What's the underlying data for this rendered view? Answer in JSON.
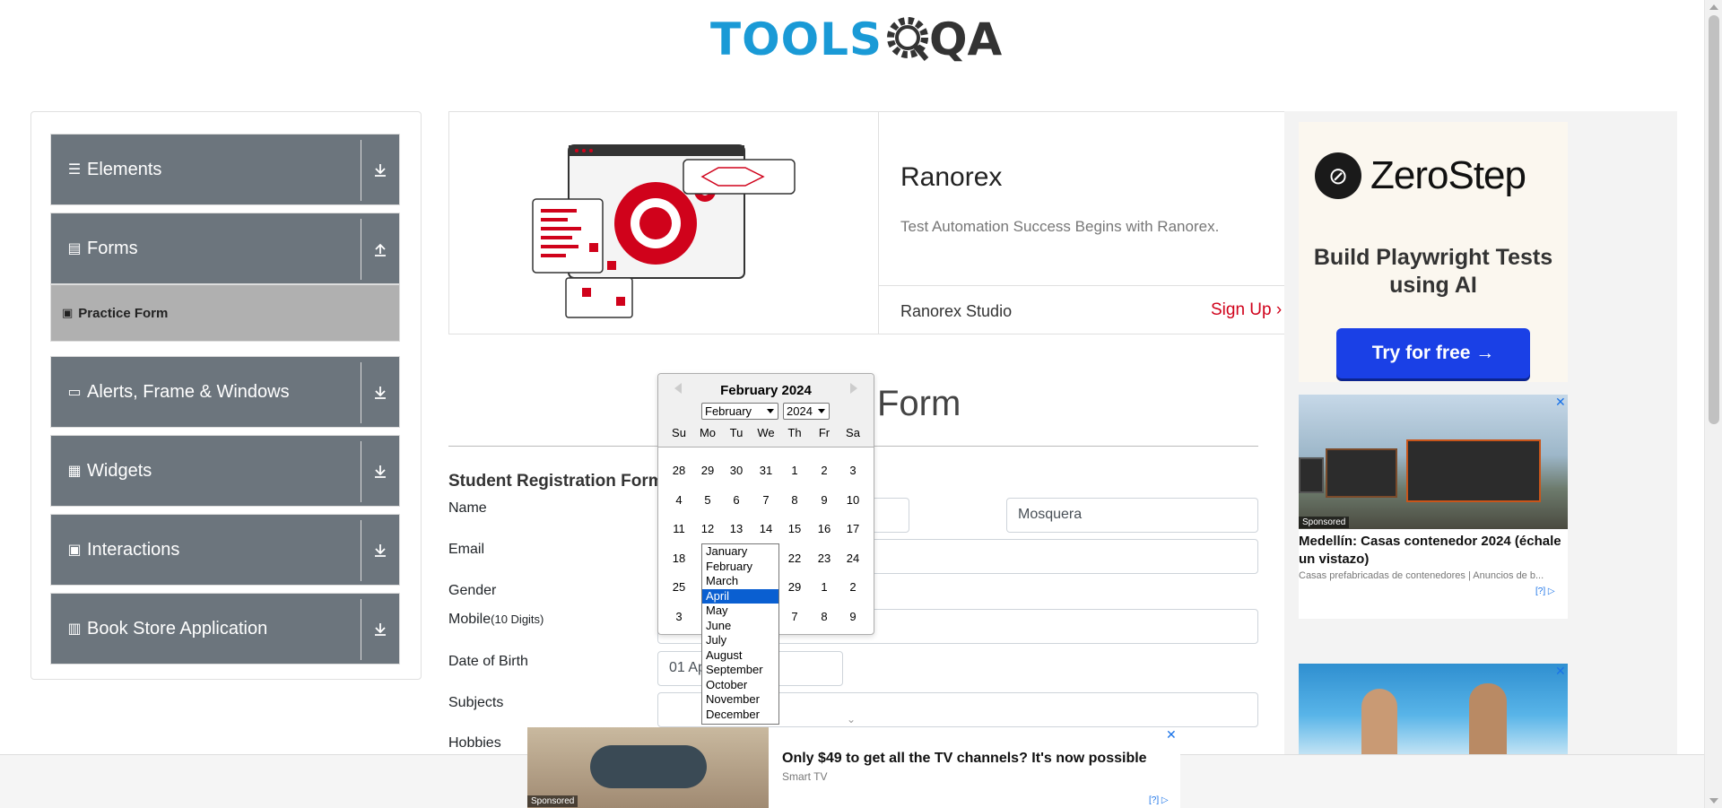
{
  "header": {
    "logo_tools": "TOOLS",
    "logo_qa": "QA"
  },
  "sidebar": {
    "groups": [
      {
        "label": "Elements",
        "icon": "hamburger-icon",
        "arrow": "download-icon"
      },
      {
        "label": "Forms",
        "icon": "document-icon",
        "arrow": "upload-icon"
      },
      {
        "label": "Alerts, Frame & Windows",
        "icon": "window-icon",
        "arrow": "download-icon"
      },
      {
        "label": "Widgets",
        "icon": "grid-icon",
        "arrow": "download-icon"
      },
      {
        "label": "Interactions",
        "icon": "interaction-icon",
        "arrow": "download-icon"
      },
      {
        "label": "Book Store Application",
        "icon": "books-icon",
        "arrow": "download-icon"
      }
    ],
    "active_item": "Practice Form"
  },
  "banner": {
    "title": "Ranorex",
    "subtitle": "Test Automation Success Begins with Ranorex.",
    "product": "Ranorex Studio",
    "cta": "Sign Up"
  },
  "form": {
    "page_title": "Form",
    "heading": "Student Registration Form",
    "labels": {
      "name": "Name",
      "email": "Email",
      "gender": "Gender",
      "mobile": "Mobile",
      "mobile_hint": "(10 Digits)",
      "dob": "Date of Birth",
      "subjects": "Subjects",
      "hobbies": "Hobbies"
    },
    "last_name_value": "Mosquera",
    "dob_value": "01 Ap"
  },
  "datepicker": {
    "header": "February 2024",
    "month_select": "February",
    "year_select": "2024",
    "weekdays": [
      "Su",
      "Mo",
      "Tu",
      "We",
      "Th",
      "Fr",
      "Sa"
    ],
    "weeks": [
      [
        "28",
        "29",
        "30",
        "31",
        "1",
        "2",
        "3"
      ],
      [
        "4",
        "5",
        "6",
        "7",
        "8",
        "9",
        "10"
      ],
      [
        "11",
        "12",
        "13",
        "14",
        "15",
        "16",
        "17"
      ],
      [
        "18",
        "",
        "",
        "",
        "22",
        "23",
        "24"
      ],
      [
        "25",
        "",
        "",
        "",
        "29",
        "1",
        "2"
      ],
      [
        "3",
        "",
        "",
        "",
        "7",
        "8",
        "9"
      ]
    ]
  },
  "month_dropdown": {
    "options": [
      "January",
      "February",
      "March",
      "April",
      "May",
      "June",
      "July",
      "August",
      "September",
      "October",
      "November",
      "December"
    ],
    "highlighted": "April"
  },
  "ads": {
    "zerostep": {
      "brand": "ZeroStep",
      "tagline": "Build Playwright Tests using AI",
      "button": "Try for free →"
    },
    "native": {
      "sponsored": "Sponsored",
      "title": "Medellín: Casas contenedor 2024 (échale un vistazo)",
      "description": "Casas prefabricadas de contenedores | Anuncios de b...",
      "adchoice": "[?]"
    },
    "bottom": {
      "sponsored": "Sponsored",
      "title": "Only $49 to get all the TV channels? It's now possible",
      "source": "Smart TV",
      "adchoice": "[?]"
    }
  }
}
